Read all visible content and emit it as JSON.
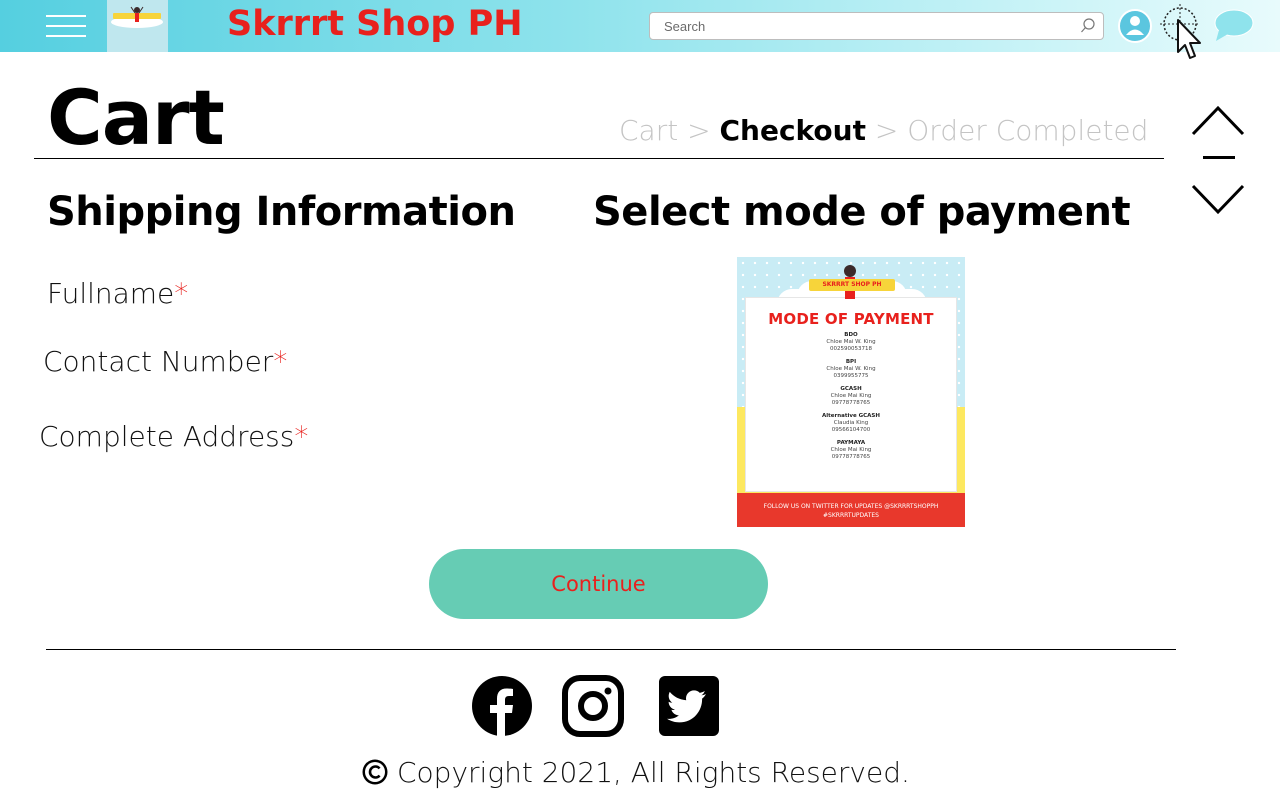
{
  "header": {
    "brand": "Skrrrt Shop PH",
    "search_placeholder": "Search",
    "icons": [
      "menu-icon",
      "logo",
      "search-icon",
      "user-icon",
      "cursor-icon",
      "chat-icon"
    ]
  },
  "page": {
    "title": "Cart",
    "breadcrumb": {
      "step1": "Cart",
      "sep1": " > ",
      "step2": "Checkout",
      "sep2": " > ",
      "step3": "Order Completed"
    }
  },
  "shipping": {
    "title": "Shipping Information",
    "fields": [
      {
        "label": "Fullname",
        "required": "*"
      },
      {
        "label": "Contact Number",
        "required": "*"
      },
      {
        "label": "Complete Address",
        "required": "*"
      }
    ]
  },
  "payment": {
    "title": "Select mode of payment",
    "poster": {
      "badge": "SKRRRT SHOP PH",
      "heading": "MODE OF PAYMENT",
      "methods": [
        {
          "bank": "BDO",
          "name": "Chloe Mai W. King",
          "number": "002590053718"
        },
        {
          "bank": "BPI",
          "name": "Chloe Mai W. King",
          "number": "0399955775"
        },
        {
          "bank": "GCASH",
          "name": "Chloe Mai King",
          "number": "09778778765"
        },
        {
          "bank": "Alternative GCASH",
          "name": "Claudia King",
          "number": "09566104700"
        },
        {
          "bank": "PAYMAYA",
          "name": "Chloe Mai King",
          "number": "09778778765"
        }
      ],
      "banner_line1": "FOLLOW US ON TWITTER FOR UPDATES @SKRRRTSHOPPH",
      "banner_line2": "#SKRRRTUPDATES"
    }
  },
  "actions": {
    "continue": "Continue"
  },
  "footer": {
    "social": [
      "facebook-icon",
      "instagram-icon",
      "twitter-icon"
    ],
    "copyright": "Copyright 2021, All Rights Reserved."
  },
  "colors": {
    "brand_red": "#e8211d",
    "header_teal": "#55cfe0",
    "button_green": "#66ccb4"
  }
}
